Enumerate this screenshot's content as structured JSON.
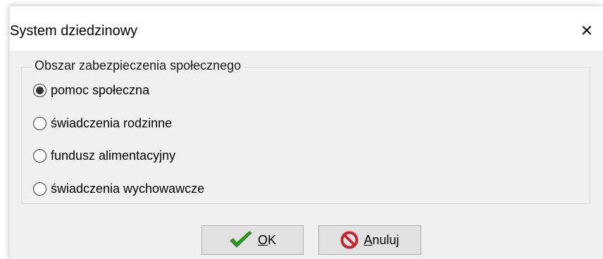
{
  "window": {
    "title": "System dziedzinowy",
    "close_label": "✕"
  },
  "group": {
    "legend": "Obszar zabezpieczenia społecznego",
    "options": [
      {
        "label": "pomoc społeczna",
        "checked": true
      },
      {
        "label": "świadczenia rodzinne",
        "checked": false
      },
      {
        "label": "fundusz alimentacyjny",
        "checked": false
      },
      {
        "label": "świadczenia wychowawcze",
        "checked": false
      }
    ]
  },
  "buttons": {
    "ok": {
      "mnemonic": "O",
      "rest": "K",
      "icon": "checkmark-icon"
    },
    "cancel": {
      "mnemonic": "A",
      "rest": "nuluj",
      "icon": "no-entry-icon"
    }
  },
  "colors": {
    "check_green": "#2e9a1f",
    "cancel_red": "#c0282d"
  }
}
